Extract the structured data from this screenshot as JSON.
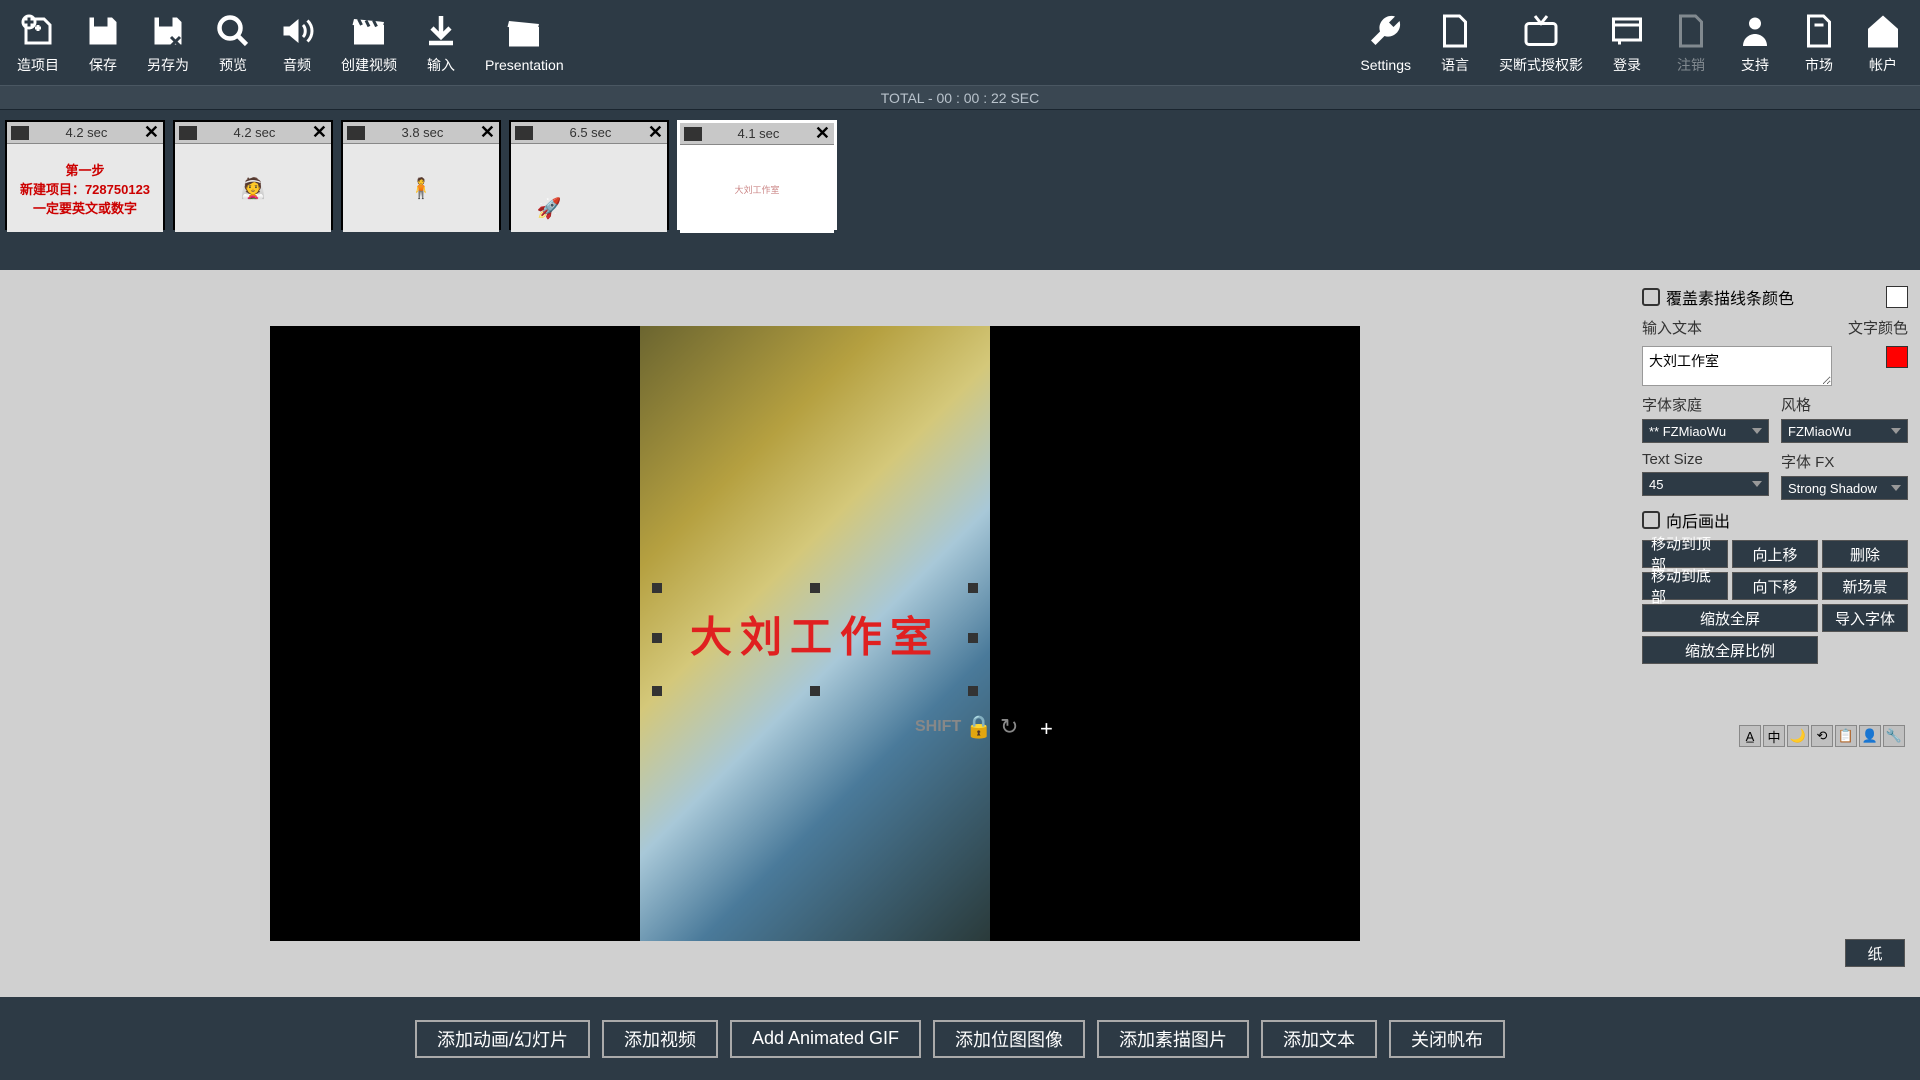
{
  "toolbar": {
    "left": [
      {
        "id": "new-project",
        "label": "造项目",
        "icon": "plus-doc"
      },
      {
        "id": "save",
        "label": "保存",
        "icon": "floppy"
      },
      {
        "id": "save-as",
        "label": "另存为",
        "icon": "floppy-x"
      },
      {
        "id": "preview",
        "label": "预览",
        "icon": "magnify"
      },
      {
        "id": "audio",
        "label": "音频",
        "icon": "speaker"
      },
      {
        "id": "create-video",
        "label": "创建视频",
        "icon": "clapper"
      },
      {
        "id": "input",
        "label": "输入",
        "icon": "download"
      },
      {
        "id": "presentation",
        "label": "Presentation",
        "icon": "clapper2"
      }
    ],
    "right": [
      {
        "id": "settings",
        "label": "Settings",
        "icon": "wrench"
      },
      {
        "id": "language",
        "label": "语言",
        "icon": "doc"
      },
      {
        "id": "buyout",
        "label": "买断式授权影",
        "icon": "tv"
      },
      {
        "id": "login",
        "label": "登录",
        "icon": "key"
      },
      {
        "id": "logout",
        "label": "注销",
        "icon": "doc-x",
        "disabled": true
      },
      {
        "id": "support",
        "label": "支持",
        "icon": "person"
      },
      {
        "id": "market",
        "label": "市场",
        "icon": "bag"
      },
      {
        "id": "account",
        "label": "帐户",
        "icon": "home"
      }
    ]
  },
  "timeline": {
    "total_label": "TOTAL - 00 : 00 : 22 SEC",
    "scenes": [
      {
        "duration": "4.2 sec",
        "type": "text",
        "lines": [
          "第一步",
          "新建项目：728750123",
          "一定要英文或数字"
        ]
      },
      {
        "duration": "4.2 sec",
        "type": "figure",
        "figure": "👰"
      },
      {
        "duration": "3.8 sec",
        "type": "figure",
        "figure": "🧍"
      },
      {
        "duration": "6.5 sec",
        "type": "figure",
        "figure": "🚀"
      },
      {
        "duration": "4.1 sec",
        "type": "tiny",
        "text": "大刘工作室",
        "selected": true
      }
    ]
  },
  "canvas": {
    "text": "大刘工作室",
    "shift_label": "SHIFT",
    "plus": "+"
  },
  "panel": {
    "override_sketch_color": "覆盖素描线条颜色",
    "input_text_label": "输入文本",
    "text_color_label": "文字颜色",
    "text_value": "大刘工作室",
    "text_color": "#ff0000",
    "font_family_label": "字体家庭",
    "font_family_value": "** FZMiaoWu",
    "style_label": "风格",
    "style_value": "FZMiaoWu",
    "text_size_label": "Text Size",
    "text_size_value": "45",
    "font_fx_label": "字体 FX",
    "font_fx_value": "Strong Shadow",
    "draw_out_back": "向后画出",
    "btns": {
      "move_top": "移动到顶部",
      "move_up": "向上移",
      "delete": "删除",
      "move_bottom": "移动到底部",
      "move_down": "向下移",
      "new_scene": "新场景",
      "fit_fullscreen": "缩放全屏",
      "import_font": "导入字体",
      "fit_ratio": "缩放全屏比例"
    },
    "mini": [
      "A̲",
      "中",
      "🌙",
      "⟲",
      "📋",
      "👤",
      "🔧"
    ],
    "paper": "纸"
  },
  "bottom": {
    "add_slide": "添加动画/幻灯片",
    "add_video": "添加视频",
    "add_gif": "Add Animated GIF",
    "add_bitmap": "添加位图图像",
    "add_sketch": "添加素描图片",
    "add_text": "添加文本",
    "close_canvas": "关闭帆布"
  }
}
